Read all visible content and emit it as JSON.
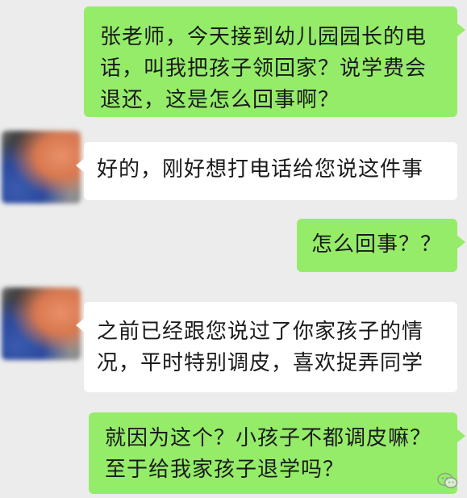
{
  "messages": [
    {
      "side": "right",
      "lines": [
        "张老师，今天接到幼儿园园长的电",
        "话，叫我把孩子领回家？说学费会",
        "退还，这是怎么回事啊？"
      ]
    },
    {
      "side": "left",
      "lines": [
        "好的，刚好想打电话给您说这件事"
      ]
    },
    {
      "side": "right",
      "lines": [
        "怎么回事？？"
      ]
    },
    {
      "side": "left",
      "lines": [
        "之前已经跟您说过了你家孩子的情",
        "况，平时特别调皮，喜欢捉弄同学"
      ]
    },
    {
      "side": "right",
      "lines": [
        "就因为这个？小孩子不都调皮嘛？",
        "至于给我家孩子退学吗？"
      ]
    }
  ],
  "colors": {
    "background": "#ececec",
    "sent_bubble": "#95ec69",
    "received_bubble": "#ffffff",
    "text": "#1a1a1a"
  },
  "icons": {
    "avatar": "blurred-avatar",
    "watermark": "wechat-watermark-icon"
  }
}
